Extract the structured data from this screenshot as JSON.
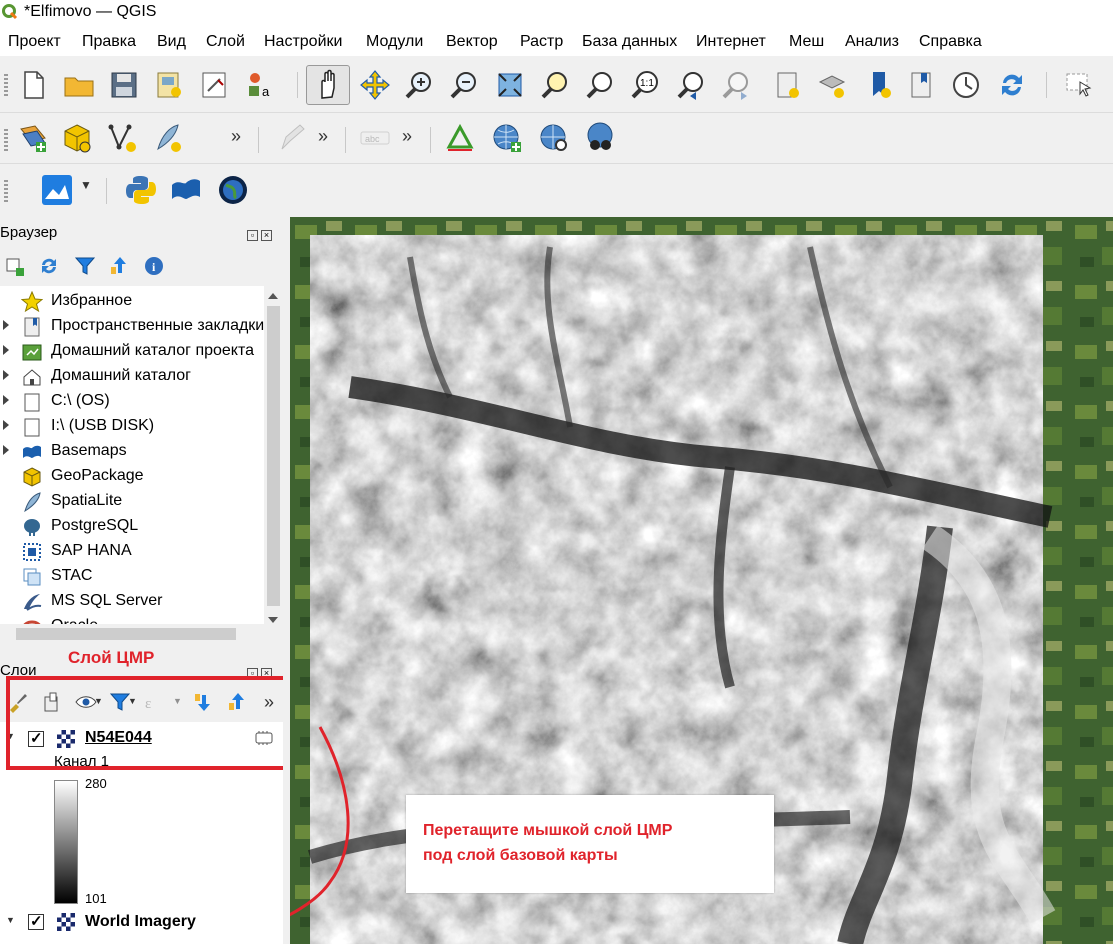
{
  "window": {
    "title": "*Elfimovo — QGIS"
  },
  "menu": [
    "Проект",
    "Правка",
    "Вид",
    "Слой",
    "Настройки",
    "Модули",
    "Вектор",
    "Растр",
    "База данных",
    "Интернет",
    "Меш",
    "Анализ",
    "Справка"
  ],
  "toolbar_icons": {
    "row1": [
      "new-project-icon",
      "open-project-icon",
      "save-project-icon",
      "new-print-layout-icon",
      "layout-manager-icon",
      "style-manager-icon",
      "pan-icon",
      "pan-to-selection-icon",
      "zoom-in-icon",
      "zoom-out-icon",
      "zoom-full-icon",
      "zoom-to-selection-icon",
      "zoom-to-layer-icon",
      "zoom-native-icon",
      "zoom-last-icon",
      "zoom-next-icon",
      "new-map-view-icon",
      "new-3d-map-view-icon",
      "new-spatial-bookmark-icon",
      "show-bookmarks-icon",
      "temporal-controller-icon",
      "refresh-icon",
      "select-features-icon"
    ],
    "row2": [
      "data-source-manager-icon",
      "new-geopackage-layer-icon",
      "new-shapefile-layer-icon",
      "new-spatialite-layer-icon",
      "digitize-icon",
      "label-icon",
      "georeferencer-icon",
      "wms-layer-icon",
      "metasearch-icon",
      "quickmapservices-icon"
    ],
    "row3": [
      "profile-tool-icon",
      "python-console-icon",
      "qgis-cloud-icon",
      "globe-icon"
    ]
  },
  "browser": {
    "title": "Браузер",
    "items": [
      {
        "label": "Избранное",
        "icon": "star-icon",
        "expand": false
      },
      {
        "label": "Пространственные закладки",
        "icon": "bookmark-icon",
        "expand": true
      },
      {
        "label": "Домашний каталог проекта",
        "icon": "project-home-icon",
        "expand": true
      },
      {
        "label": "Домашний каталог",
        "icon": "home-folder-icon",
        "expand": true
      },
      {
        "label": "C:\\ (OS)",
        "icon": "folder-icon",
        "expand": true
      },
      {
        "label": "I:\\ (USB DISK)",
        "icon": "folder-icon",
        "expand": true
      },
      {
        "label": "Basemaps",
        "icon": "basemaps-icon",
        "expand": true
      },
      {
        "label": "GeoPackage",
        "icon": "geopackage-icon",
        "expand": false
      },
      {
        "label": "SpatiaLite",
        "icon": "spatialite-icon",
        "expand": false
      },
      {
        "label": "PostgreSQL",
        "icon": "postgresql-icon",
        "expand": false
      },
      {
        "label": "SAP HANA",
        "icon": "sap-hana-icon",
        "expand": false
      },
      {
        "label": "STAC",
        "icon": "stac-icon",
        "expand": false
      },
      {
        "label": "MS SQL Server",
        "icon": "mssql-icon",
        "expand": false
      },
      {
        "label": "Oracle",
        "icon": "oracle-icon",
        "expand": false
      }
    ]
  },
  "layers": {
    "title": "Слои",
    "items": [
      {
        "name": "N54E044",
        "checked": true,
        "band": "Канал 1",
        "max": "280",
        "min": "101"
      },
      {
        "name": "World Imagery",
        "checked": true
      }
    ]
  },
  "annotations": {
    "layer_label": "Слой ЦМР",
    "instruction_line1": "Перетащите мышкой слой ЦМР",
    "instruction_line2": "под слой базовой карты"
  },
  "colors": {
    "annotation_red": "#e0232b",
    "panel_bg": "#f0f0f0"
  }
}
